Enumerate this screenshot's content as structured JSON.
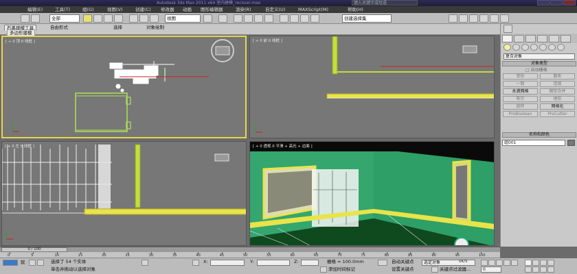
{
  "title_bar": {
    "window_title": "Autodesk 3ds Max  2011 x64      室内建模_recover.max",
    "search_placeholder": "键入关键字或短语"
  },
  "menu": [
    "编辑(E)",
    "工具(T)",
    "组(G)",
    "视图(V)",
    "创建(C)",
    "修改器",
    "动画",
    "图形编辑器",
    "渲染(R)",
    "自定义(U)",
    "MAXScript(M)",
    "帮助(H)"
  ],
  "toolbar": {
    "selection_filter": "全部",
    "reference_coord": "视图",
    "named_selection": "创建选择集"
  },
  "ribbon": {
    "tabs": [
      "石墨建模工具",
      "自由形式",
      "选择",
      "对象绘制"
    ],
    "active_tab_index": 0,
    "sub_tab": "多边形建模"
  },
  "viewports": [
    {
      "label": "[ + 0 顶 0 线框 ]",
      "name": "top"
    },
    {
      "label": "[ + 0 前 0 线框 ]",
      "name": "front"
    },
    {
      "label": "[ + 0 左 0 线框 ]",
      "name": "left"
    },
    {
      "label": "[ + 0 透视 0 平滑 + 高光 + 边面 ]",
      "name": "perspective"
    }
  ],
  "command_panel": {
    "category": "复合对象",
    "rollout_object_type": "对象类型",
    "auto_grid": "自动栅格",
    "object_buttons": [
      {
        "label": "变形",
        "enabled": false
      },
      {
        "label": "散布",
        "enabled": false
      },
      {
        "label": "一致",
        "enabled": false
      },
      {
        "label": "连接",
        "enabled": false
      },
      {
        "label": "水滴网格",
        "enabled": true
      },
      {
        "label": "图形合并",
        "enabled": false
      },
      {
        "label": "布尔",
        "enabled": false
      },
      {
        "label": "地形",
        "enabled": false
      },
      {
        "label": "放样",
        "enabled": false
      },
      {
        "label": "网格化",
        "enabled": true
      },
      {
        "label": "ProBoolean",
        "enabled": false
      },
      {
        "label": "ProCutter",
        "enabled": false
      }
    ],
    "rollout_name_color": "名称和颜色",
    "object_name": "组001",
    "swatch_color": "#777777"
  },
  "time_slider": {
    "label": "0 / 100"
  },
  "ruler_ticks": [
    "0",
    "5",
    "10",
    "15",
    "20",
    "25",
    "30",
    "35",
    "40",
    "45",
    "50",
    "55",
    "60",
    "65",
    "70",
    "75",
    "80",
    "85",
    "90",
    "95",
    "100"
  ],
  "status": {
    "selection_info": "选择了 54 个实体",
    "prompt": "单击并拖动以选择对象",
    "grid": "栅格 = 100.0mm",
    "add_time_tag": "添加时间标记",
    "auto_key": "自动关键点",
    "set_key": "设置关键点",
    "selected_object": "选定对象",
    "key_filters": "关键点过滤器...",
    "frame": "0",
    "view_fps": "0K/S",
    "taskbar_text": "就"
  }
}
